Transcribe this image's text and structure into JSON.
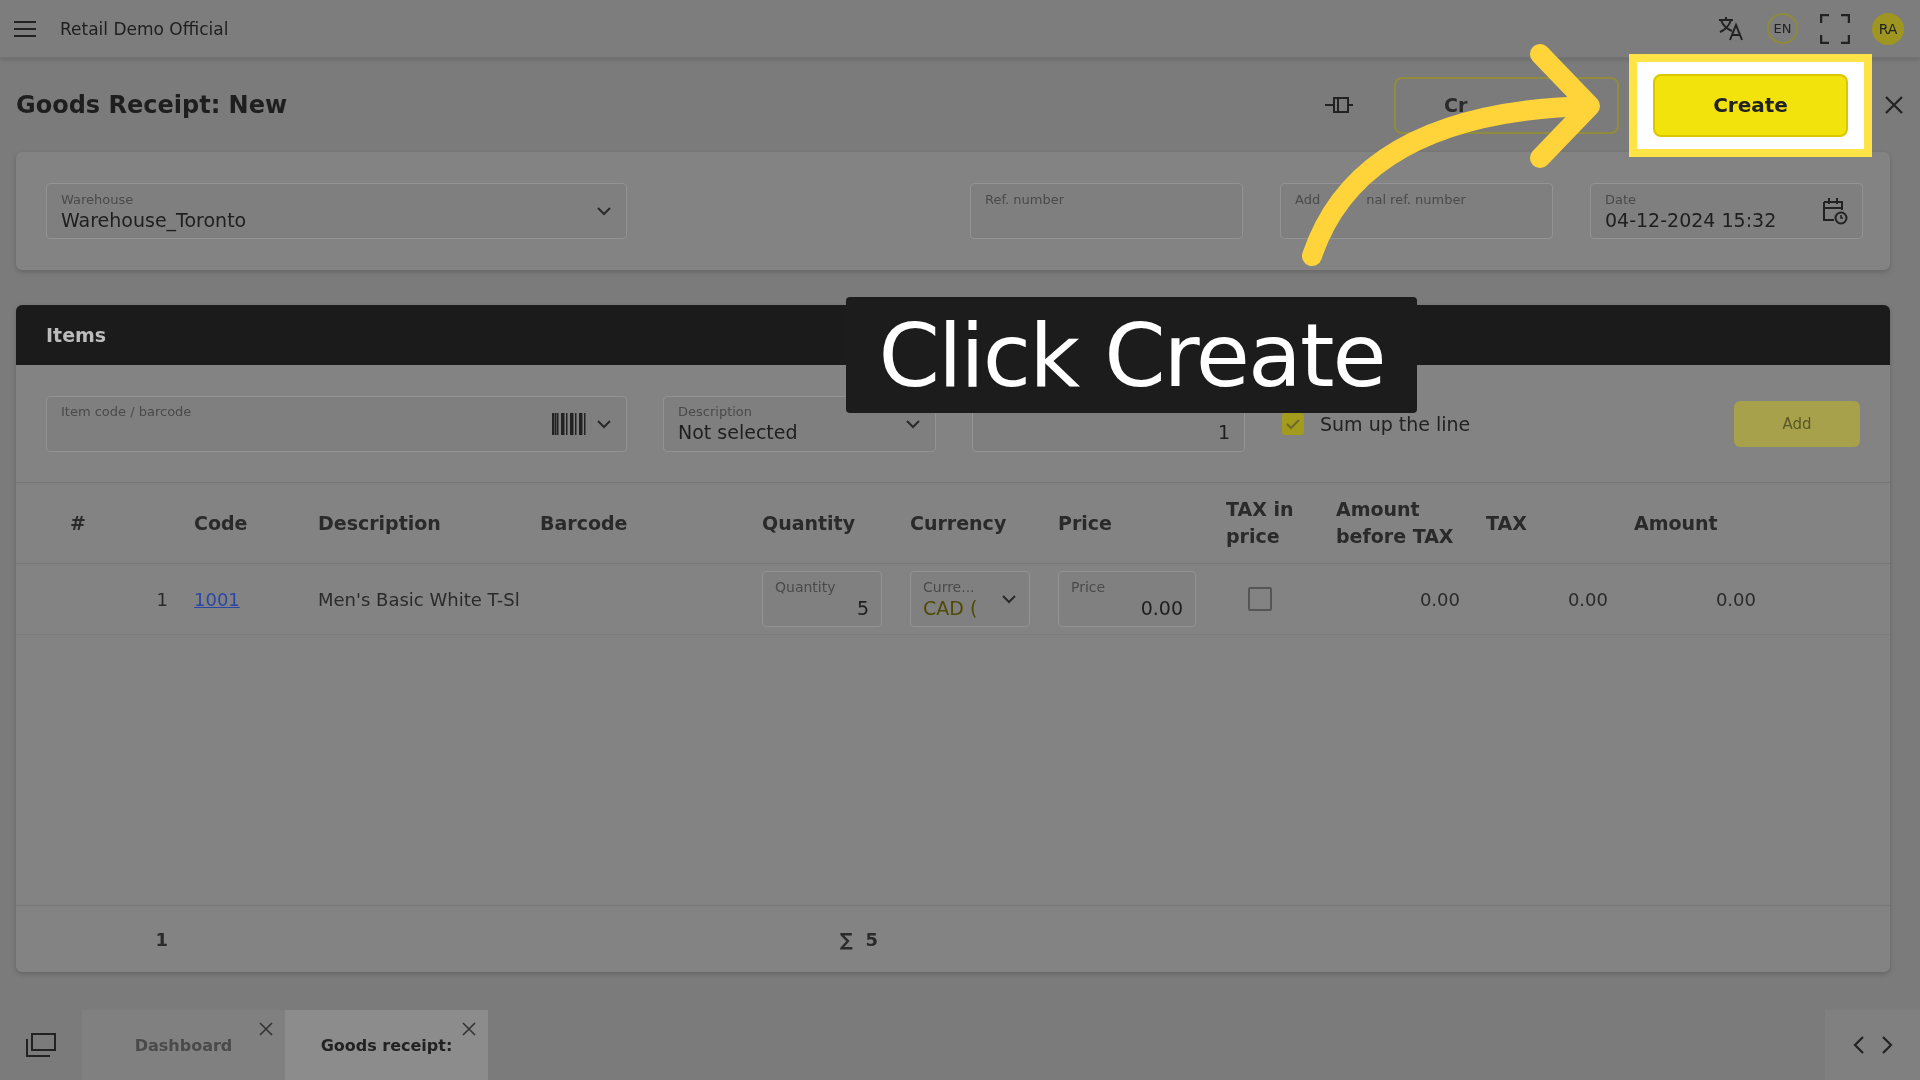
{
  "app": {
    "title": "Retail Demo Official",
    "language": "EN",
    "user_initials": "RA"
  },
  "page": {
    "title": "Goods Receipt: New",
    "secondary_button": "Cr",
    "primary_button": "Create"
  },
  "form_fields": [
    {
      "kind": "select",
      "label": "Warehouse",
      "value": "Warehouse_Toronto"
    },
    {
      "kind": "text",
      "label": "Ref. number"
    },
    {
      "kind": "text",
      "label_parts": [
        "Add",
        "nal ref. number"
      ]
    },
    {
      "kind": "date",
      "label": "Date",
      "value": "04-12-2024 15:32"
    }
  ],
  "items": {
    "title": "Items",
    "item_field": {
      "label": "Item code / barcode"
    },
    "description_field": {
      "label": "Description",
      "value": "Not selected"
    },
    "quantity_field": {
      "value": "1"
    },
    "sum_up": {
      "label": "Sum up the line",
      "checked": true
    },
    "add_button": {
      "label": "Add",
      "disabled": true
    }
  },
  "table": {
    "columns": [
      "#",
      "Code",
      "Description",
      "Barcode",
      "Quantity",
      "Currency",
      "Price",
      "TAX in price",
      "Amount before TAX",
      "TAX",
      "Amount"
    ],
    "rows": [
      {
        "number": "1",
        "code": "1001",
        "description": "Men's Basic White T-Sl",
        "quantity_label": "Quantity",
        "quantity": "5",
        "currency_label": "Curre...",
        "currency": "CAD (",
        "price_label": "Price",
        "price": "0.00",
        "tax_in_price": false,
        "amount_before_tax": "0.00",
        "tax": "0.00",
        "amount": "0.00"
      }
    ],
    "footer": {
      "count": "1",
      "sum_symbol": "∑",
      "quantity_sum": "5"
    }
  },
  "bottom_tabs": [
    {
      "label": "Dashboard",
      "selected": false
    },
    {
      "label": "Goods receipt:",
      "selected": true
    }
  ],
  "callout": {
    "text": "Click Create"
  }
}
